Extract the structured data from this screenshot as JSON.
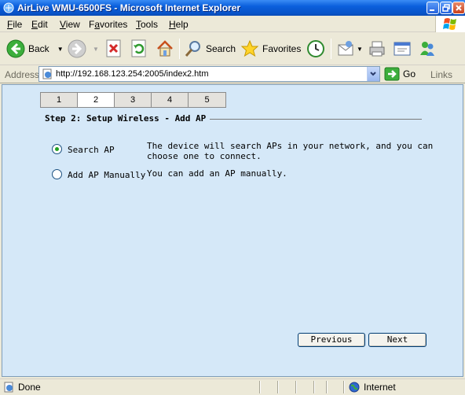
{
  "window": {
    "title": "AirLive WMU-6500FS - Microsoft Internet Explorer"
  },
  "menu": {
    "items": [
      {
        "pre": "",
        "u": "F",
        "post": "ile"
      },
      {
        "pre": "",
        "u": "E",
        "post": "dit"
      },
      {
        "pre": "",
        "u": "V",
        "post": "iew"
      },
      {
        "pre": "F",
        "u": "a",
        "post": "vorites"
      },
      {
        "pre": "",
        "u": "T",
        "post": "ools"
      },
      {
        "pre": "",
        "u": "H",
        "post": "elp"
      }
    ]
  },
  "toolbar": {
    "back_label": "Back",
    "search_label": "Search",
    "favorites_label": "Favorites"
  },
  "address": {
    "label": "Address",
    "url": "http://192.168.123.254:2005/index2.htm",
    "go_label": "Go",
    "links_label": "Links"
  },
  "wizard": {
    "steps": [
      "1",
      "2",
      "3",
      "4",
      "5"
    ],
    "active_step": "2",
    "section_title": "Step 2: Setup Wireless - Add AP",
    "options": [
      {
        "label": "Search AP",
        "selected": true,
        "desc_line1": "The device will search APs in your network, and you can",
        "desc_line2": "choose one to connect."
      },
      {
        "label": "Add AP Manually",
        "selected": false,
        "desc_line1": "You can add an AP manually.",
        "desc_line2": ""
      }
    ],
    "previous_label": "Previous",
    "next_label": "Next"
  },
  "status": {
    "text": "Done",
    "zone": "Internet"
  },
  "colors": {
    "content_bg": "#d5e8f8",
    "titlebar": "#0a5fdc",
    "radio_selected": "#21a121"
  }
}
